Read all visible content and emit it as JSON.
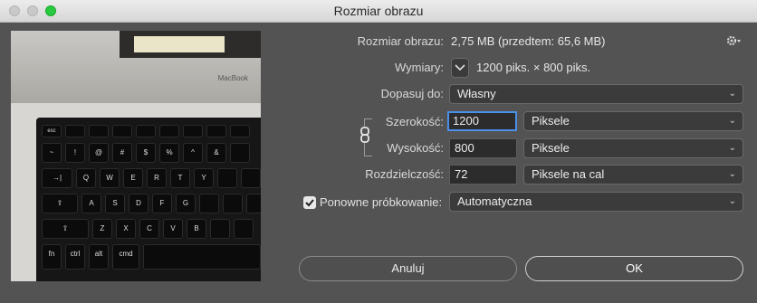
{
  "window": {
    "title": "Rozmiar obrazu"
  },
  "preview": {
    "brand": "MacBook"
  },
  "image_size": {
    "label": "Rozmiar obrazu:",
    "value": "2,75 MB (przedtem: 65,6 MB)"
  },
  "dimensions": {
    "label": "Wymiary:",
    "value": "1200 piks. × 800 piks."
  },
  "fit_to": {
    "label": "Dopasuj do:",
    "value": "Własny"
  },
  "width": {
    "label": "Szerokość:",
    "value": "1200",
    "unit": "Piksele"
  },
  "height": {
    "label": "Wysokość:",
    "value": "800",
    "unit": "Piksele"
  },
  "resolution": {
    "label": "Rozdzielczość:",
    "value": "72",
    "unit": "Piksele na cal"
  },
  "resample": {
    "label": "Ponowne próbkowanie:",
    "checked": true,
    "value": "Automatyczna"
  },
  "buttons": {
    "cancel": "Anuluj",
    "ok": "OK"
  },
  "keys": {
    "row_fn": [
      "esc",
      "",
      "",
      "",
      "",
      "",
      "",
      ""
    ],
    "row_num": [
      "~",
      "!",
      "@",
      "#",
      "$",
      "%",
      "^",
      "&"
    ],
    "row_q": [
      "→|",
      "Q",
      "W",
      "E",
      "R",
      "T",
      "Y"
    ],
    "row_a": [
      "⇪",
      "A",
      "S",
      "D",
      "F",
      "G"
    ],
    "row_z": [
      "⇧",
      "Z",
      "X",
      "C",
      "V",
      "B"
    ],
    "row_b": [
      "fn",
      "ctrl",
      "alt",
      "cmd",
      ""
    ]
  }
}
